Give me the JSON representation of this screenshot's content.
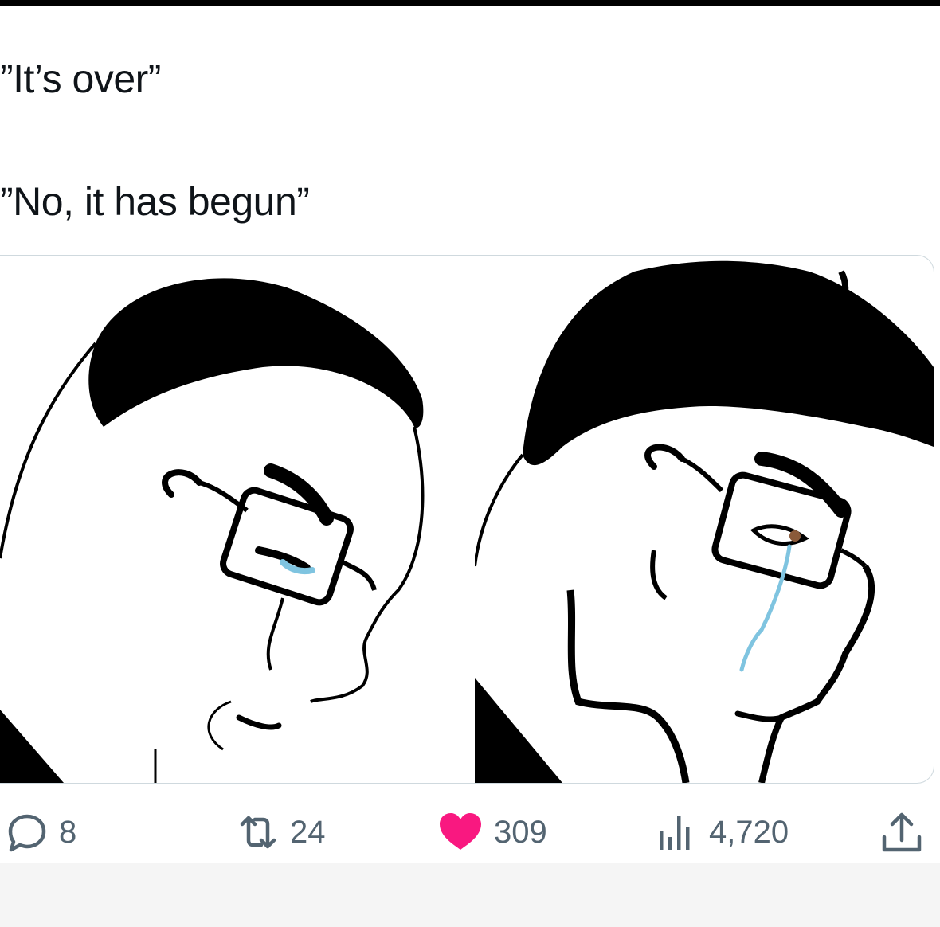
{
  "tweet": {
    "line1": "”It’s over”",
    "line2": "”No, it has begun”"
  },
  "media": {
    "left_panel": "crying-wojak-glasses-looking-down",
    "right_panel": "crying-wojak-glasses-determined"
  },
  "actions": {
    "replies": "8",
    "retweets": "24",
    "likes": "309",
    "views": "4,720"
  },
  "icons": [
    "reply-icon",
    "retweet-icon",
    "like-icon",
    "views-icon",
    "share-icon"
  ],
  "colors": {
    "text": "#0f1419",
    "secondary": "#536471",
    "like": "#f91880",
    "tear": "#7fc4e0"
  }
}
